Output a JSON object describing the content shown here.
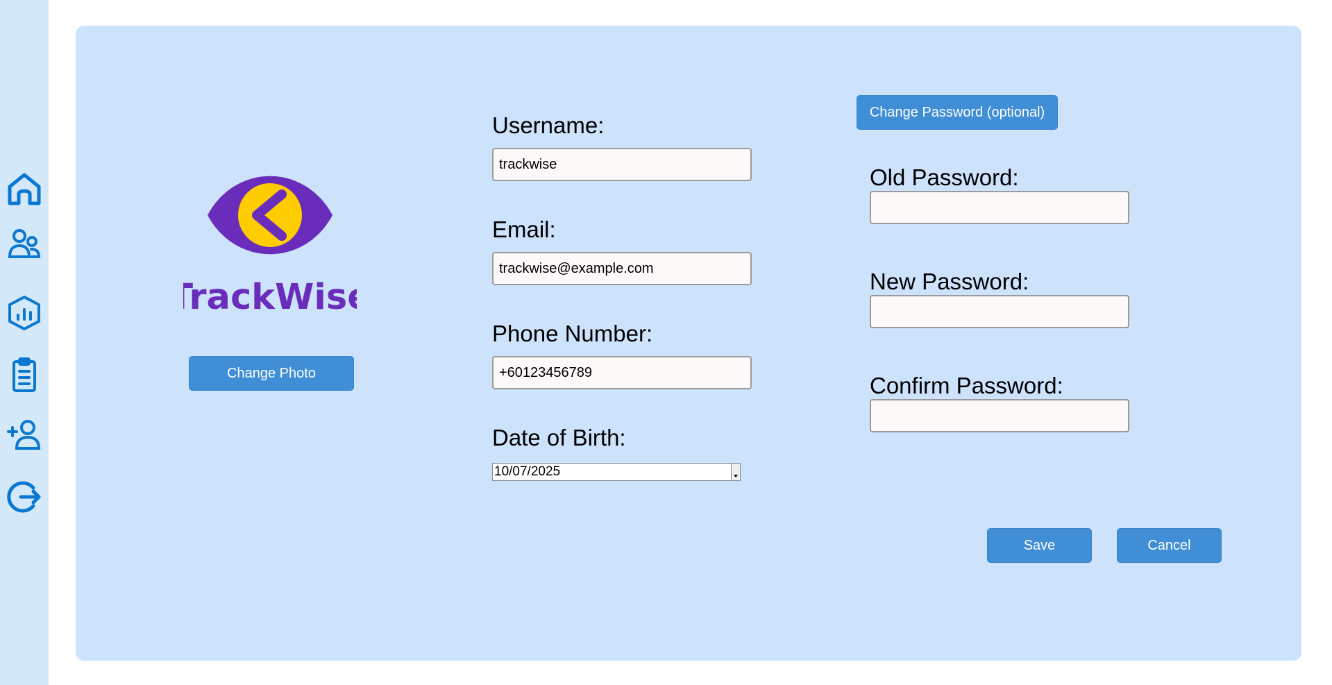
{
  "sidebar": {
    "items": [
      {
        "name": "home",
        "icon": "home-icon"
      },
      {
        "name": "users",
        "icon": "users-icon"
      },
      {
        "name": "analytics",
        "icon": "analytics-hexagon-icon"
      },
      {
        "name": "reports",
        "icon": "clipboard-icon"
      },
      {
        "name": "add-user",
        "icon": "user-plus-icon"
      },
      {
        "name": "logout",
        "icon": "logout-icon"
      }
    ],
    "icon_color": "#0a77d0"
  },
  "profile": {
    "logo_text": "TrackWise",
    "change_photo_label": "Change Photo"
  },
  "form": {
    "username_label": "Username:",
    "username_value": "trackwise",
    "email_label": "Email:",
    "email_value": "trackwise@example.com",
    "phone_label": "Phone Number:",
    "phone_value": "+60123456789",
    "dob_label": "Date of Birth:",
    "dob_value": "10/07/2025"
  },
  "password": {
    "toggle_label": "Change Password (optional)",
    "old_label": "Old Password:",
    "old_value": "",
    "new_label": "New Password:",
    "new_value": "",
    "confirm_label": "Confirm Password:",
    "confirm_value": ""
  },
  "actions": {
    "save_label": "Save",
    "cancel_label": "Cancel"
  },
  "colors": {
    "button": "#3f8ed6",
    "card": "#cde3fb",
    "sidebar": "#d3e8f9",
    "logo_purple": "#6a2dbb",
    "logo_yellow": "#ffcc00"
  }
}
